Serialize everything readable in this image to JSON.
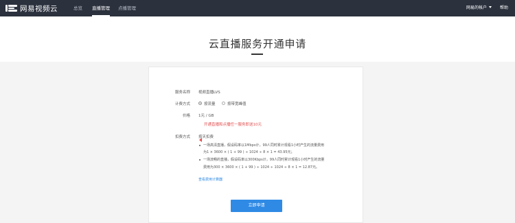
{
  "header": {
    "logo_text": "网易视频云",
    "nav": [
      {
        "label": "总览",
        "active": false
      },
      {
        "label": "直播管理",
        "active": true
      },
      {
        "label": "点播管理",
        "active": false
      }
    ],
    "account_label": "网易的帐户",
    "help_label": "帮助"
  },
  "page": {
    "title": "云直播服务开通申请"
  },
  "form": {
    "service_name": {
      "label": "服务名称",
      "value": "视频直播LVS"
    },
    "billing_method": {
      "label": "计费方式",
      "options": [
        {
          "label": "按流量",
          "checked": true
        },
        {
          "label": "按带宽峰值",
          "checked": false
        }
      ]
    },
    "price": {
      "label": "价格",
      "value": "1元 / GB",
      "warning": "开通直播和点播任一服务即送10元"
    },
    "deduction": {
      "label": "扣费方式",
      "value": "按天扣费",
      "examples": [
        [
          "一场高清直播，假设码率以1Mbps计，99人同时累计观看1小时产生的流量费用",
          "为1 × 3600 × ( 1 + 99 ) ÷ 1024 ÷ 8 × 1 = 43.95元；"
        ],
        [
          "一场流畅的直播，假设码率以300Kbps计，99人同时累计观看1小时产生的流量",
          "费用为300 × 3600 × ( 1 + 99 ) ÷ 1024 ÷ 1024 ÷ 8 × 1 = 12.87元。"
        ]
      ],
      "link": "查看费用计算器"
    },
    "submit_label": "立即申请"
  },
  "colors": {
    "topbar": "#2b313d",
    "accent": "#2f8ae5",
    "warning": "#e34d4d"
  }
}
